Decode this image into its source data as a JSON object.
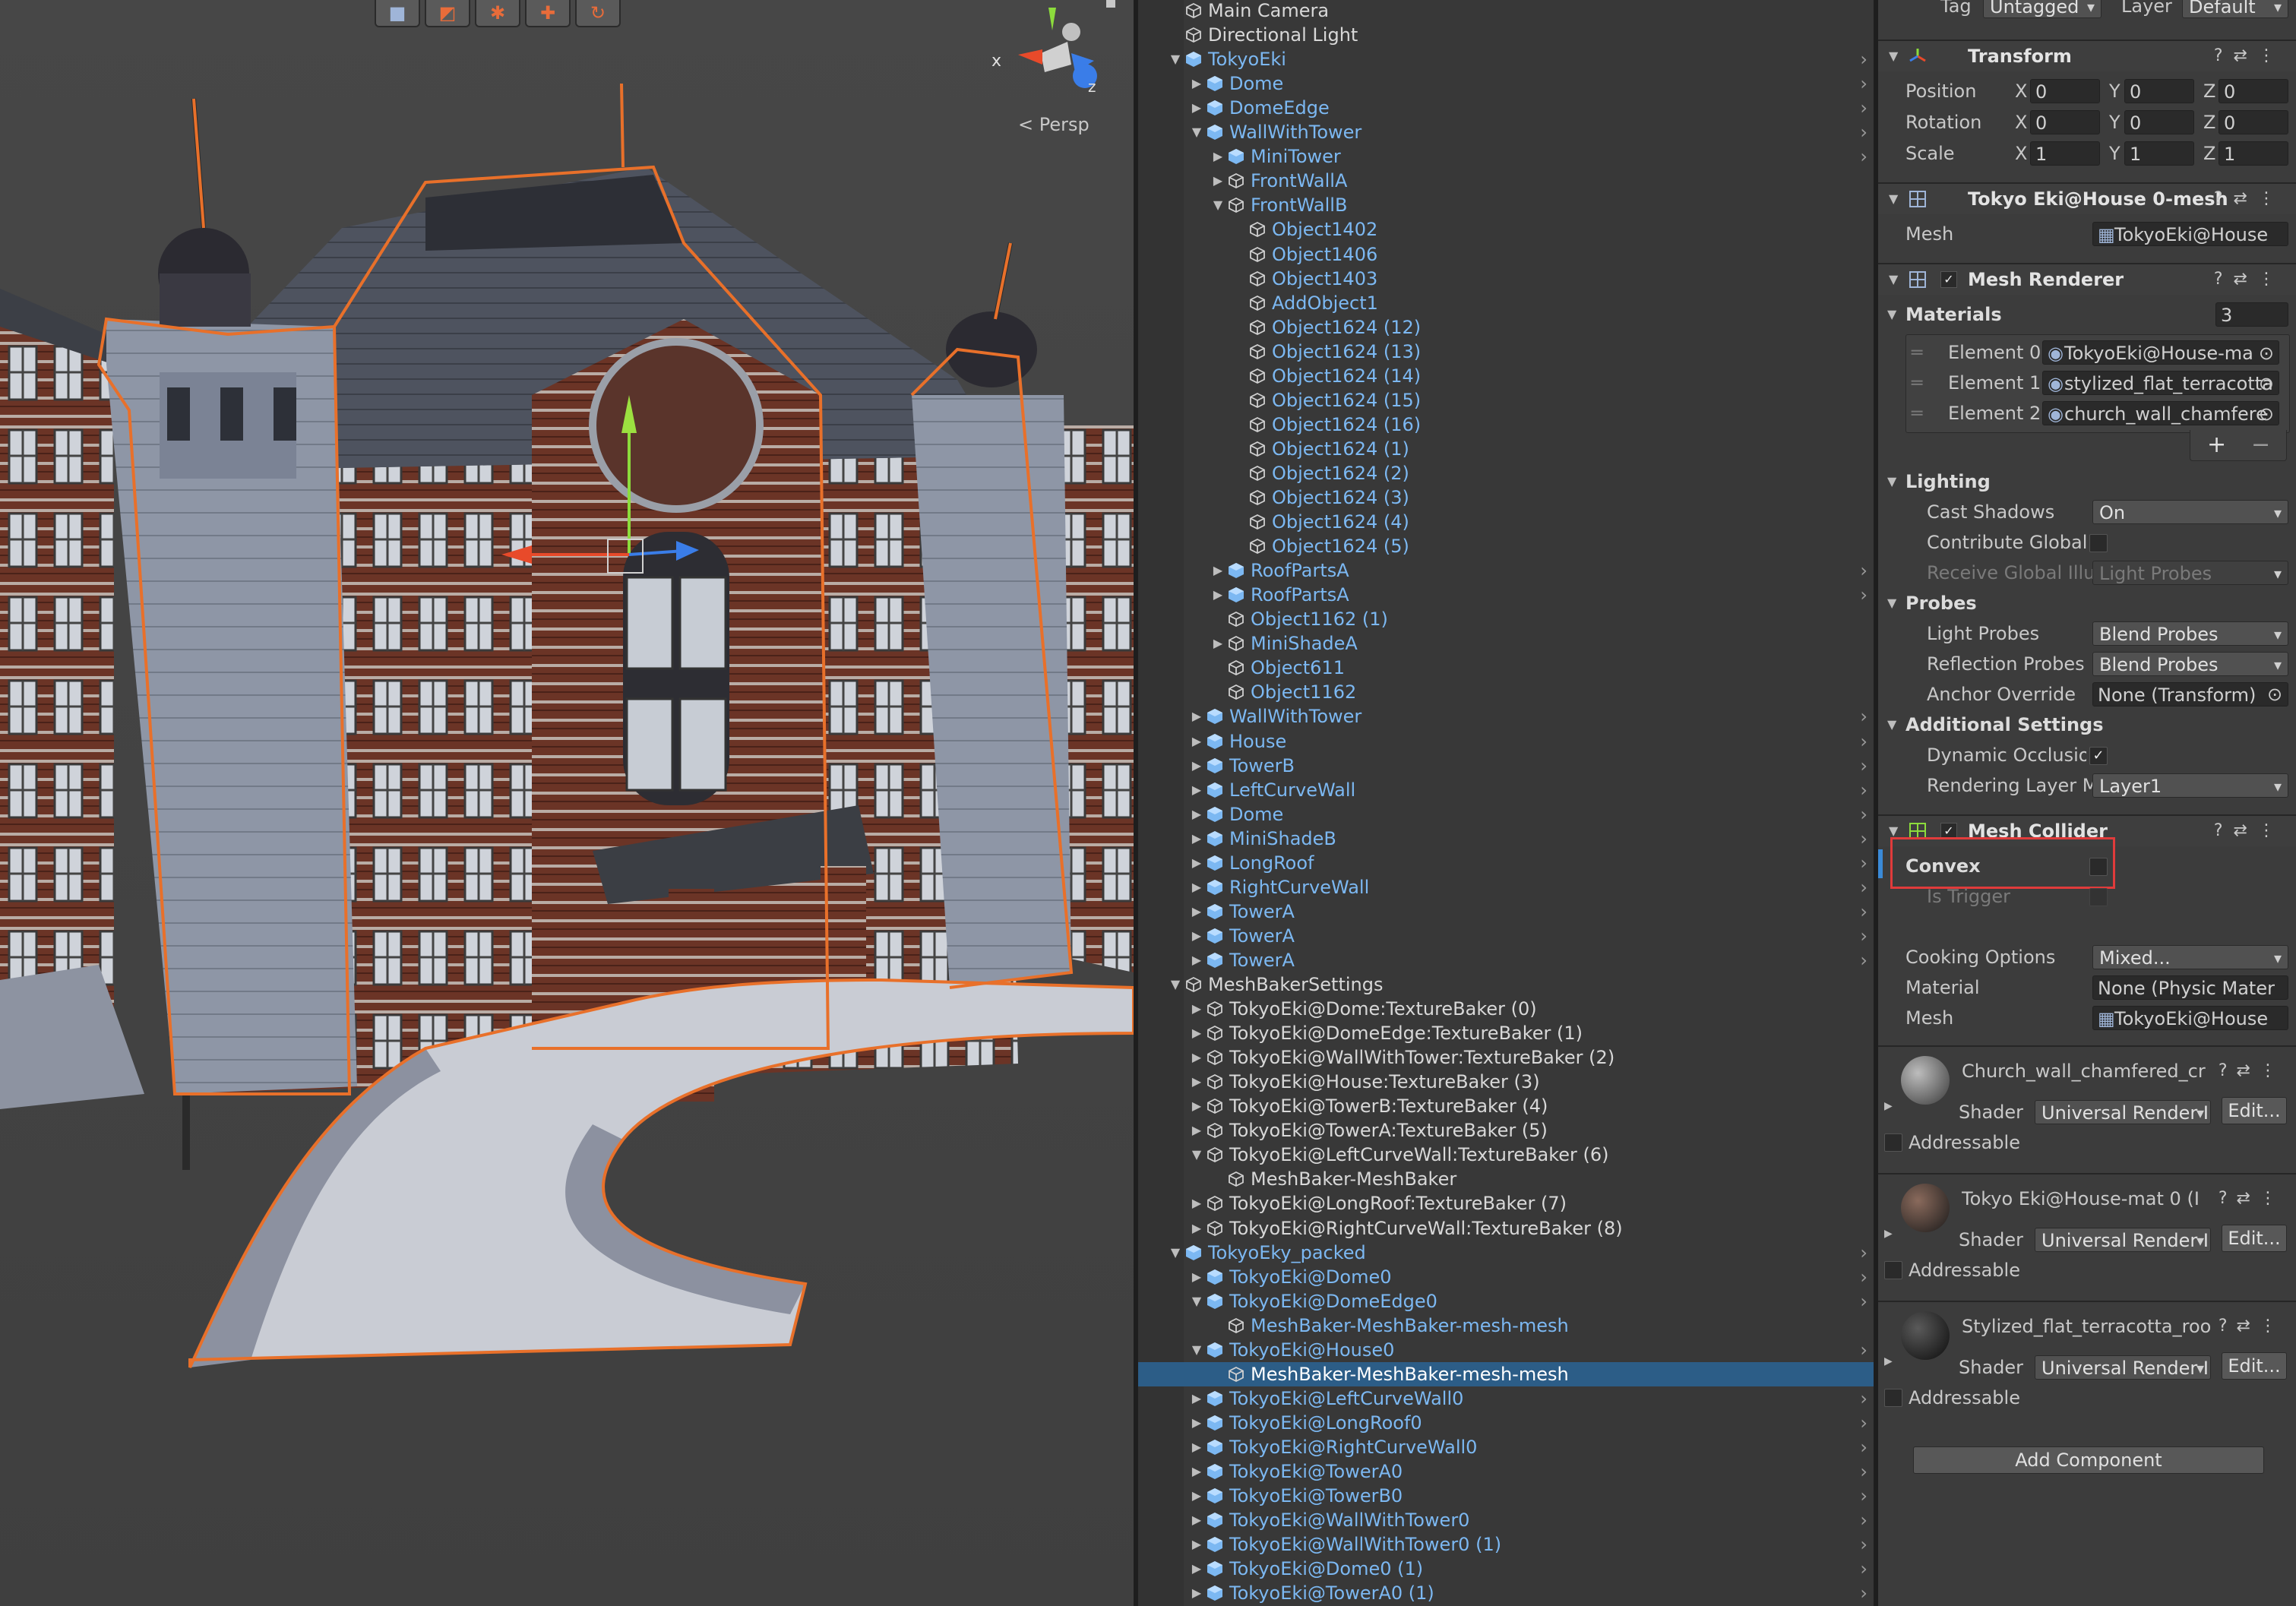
{
  "scene_view": {
    "tools": [
      "cube-icon",
      "rect-tool-icon",
      "gear-icon",
      "pivot-icon",
      "rotate-icon"
    ],
    "gizmo_axes": {
      "x": "x",
      "z": "z"
    },
    "projection_label": "Persp"
  },
  "hierarchy": {
    "rows": [
      {
        "label": "Main Camera",
        "depth": 0,
        "arrow": "",
        "type": "go",
        "chev": false
      },
      {
        "label": "Directional Light",
        "depth": 0,
        "arrow": "",
        "type": "go",
        "chev": false
      },
      {
        "label": "TokyoEki",
        "depth": 0,
        "arrow": "down",
        "type": "prefab-root",
        "chev": true
      },
      {
        "label": "Dome",
        "depth": 1,
        "arrow": "right",
        "type": "prefab",
        "chev": true
      },
      {
        "label": "DomeEdge",
        "depth": 1,
        "arrow": "right",
        "type": "prefab",
        "chev": true
      },
      {
        "label": "WallWithTower",
        "depth": 1,
        "arrow": "down",
        "type": "prefab",
        "chev": true
      },
      {
        "label": "MiniTower",
        "depth": 2,
        "arrow": "right",
        "type": "prefab",
        "chev": true
      },
      {
        "label": "FrontWallA",
        "depth": 2,
        "arrow": "right",
        "type": "prefab-go",
        "chev": false
      },
      {
        "label": "FrontWallB",
        "depth": 2,
        "arrow": "down",
        "type": "prefab-go",
        "chev": false
      },
      {
        "label": "Object1402",
        "depth": 3,
        "arrow": "",
        "type": "prefab-go",
        "chev": false
      },
      {
        "label": "Object1406",
        "depth": 3,
        "arrow": "",
        "type": "prefab-go",
        "chev": false
      },
      {
        "label": "Object1403",
        "depth": 3,
        "arrow": "",
        "type": "prefab-go",
        "chev": false
      },
      {
        "label": "AddObject1",
        "depth": 3,
        "arrow": "",
        "type": "prefab-go",
        "chev": false
      },
      {
        "label": "Object1624 (12)",
        "depth": 3,
        "arrow": "",
        "type": "prefab-go",
        "chev": false
      },
      {
        "label": "Object1624 (13)",
        "depth": 3,
        "arrow": "",
        "type": "prefab-go",
        "chev": false
      },
      {
        "label": "Object1624 (14)",
        "depth": 3,
        "arrow": "",
        "type": "prefab-go",
        "chev": false
      },
      {
        "label": "Object1624 (15)",
        "depth": 3,
        "arrow": "",
        "type": "prefab-go",
        "chev": false
      },
      {
        "label": "Object1624 (16)",
        "depth": 3,
        "arrow": "",
        "type": "prefab-go",
        "chev": false
      },
      {
        "label": "Object1624 (1)",
        "depth": 3,
        "arrow": "",
        "type": "prefab-go",
        "chev": false
      },
      {
        "label": "Object1624 (2)",
        "depth": 3,
        "arrow": "",
        "type": "prefab-go",
        "chev": false
      },
      {
        "label": "Object1624 (3)",
        "depth": 3,
        "arrow": "",
        "type": "prefab-go",
        "chev": false
      },
      {
        "label": "Object1624 (4)",
        "depth": 3,
        "arrow": "",
        "type": "prefab-go",
        "chev": false
      },
      {
        "label": "Object1624 (5)",
        "depth": 3,
        "arrow": "",
        "type": "prefab-go",
        "chev": false
      },
      {
        "label": "RoofPartsA",
        "depth": 2,
        "arrow": "right",
        "type": "prefab",
        "chev": true
      },
      {
        "label": "RoofPartsA",
        "depth": 2,
        "arrow": "right",
        "type": "prefab",
        "chev": true
      },
      {
        "label": "Object1162 (1)",
        "depth": 2,
        "arrow": "",
        "type": "prefab-go",
        "chev": false
      },
      {
        "label": "MiniShadeA",
        "depth": 2,
        "arrow": "right",
        "type": "prefab-go",
        "chev": false
      },
      {
        "label": "Object611",
        "depth": 2,
        "arrow": "",
        "type": "prefab-go",
        "chev": false
      },
      {
        "label": "Object1162",
        "depth": 2,
        "arrow": "",
        "type": "prefab-go",
        "chev": false
      },
      {
        "label": "WallWithTower",
        "depth": 1,
        "arrow": "right",
        "type": "prefab",
        "chev": true
      },
      {
        "label": "House",
        "depth": 1,
        "arrow": "right",
        "type": "prefab",
        "chev": true
      },
      {
        "label": "TowerB",
        "depth": 1,
        "arrow": "right",
        "type": "prefab",
        "chev": true
      },
      {
        "label": "LeftCurveWall",
        "depth": 1,
        "arrow": "right",
        "type": "prefab",
        "chev": true
      },
      {
        "label": "Dome",
        "depth": 1,
        "arrow": "right",
        "type": "prefab",
        "chev": true
      },
      {
        "label": "MiniShadeB",
        "depth": 1,
        "arrow": "right",
        "type": "prefab",
        "chev": true
      },
      {
        "label": "LongRoof",
        "depth": 1,
        "arrow": "right",
        "type": "prefab",
        "chev": true
      },
      {
        "label": "RightCurveWall",
        "depth": 1,
        "arrow": "right",
        "type": "prefab",
        "chev": true
      },
      {
        "label": "TowerA",
        "depth": 1,
        "arrow": "right",
        "type": "prefab",
        "chev": true
      },
      {
        "label": "TowerA",
        "depth": 1,
        "arrow": "right",
        "type": "prefab",
        "chev": true
      },
      {
        "label": "TowerA",
        "depth": 1,
        "arrow": "right",
        "type": "prefab",
        "chev": true
      },
      {
        "label": "MeshBakerSettings",
        "depth": 0,
        "arrow": "down",
        "type": "go",
        "chev": false
      },
      {
        "label": "TokyoEki@Dome:TextureBaker (0)",
        "depth": 1,
        "arrow": "right",
        "type": "go",
        "chev": false
      },
      {
        "label": "TokyoEki@DomeEdge:TextureBaker (1)",
        "depth": 1,
        "arrow": "right",
        "type": "go",
        "chev": false
      },
      {
        "label": "TokyoEki@WallWithTower:TextureBaker (2)",
        "depth": 1,
        "arrow": "right",
        "type": "go",
        "chev": false
      },
      {
        "label": "TokyoEki@House:TextureBaker (3)",
        "depth": 1,
        "arrow": "right",
        "type": "go",
        "chev": false
      },
      {
        "label": "TokyoEki@TowerB:TextureBaker (4)",
        "depth": 1,
        "arrow": "right",
        "type": "go",
        "chev": false
      },
      {
        "label": "TokyoEki@TowerA:TextureBaker (5)",
        "depth": 1,
        "arrow": "right",
        "type": "go",
        "chev": false
      },
      {
        "label": "TokyoEki@LeftCurveWall:TextureBaker (6)",
        "depth": 1,
        "arrow": "down",
        "type": "go",
        "chev": false
      },
      {
        "label": "MeshBaker-MeshBaker",
        "depth": 2,
        "arrow": "",
        "type": "go",
        "chev": false
      },
      {
        "label": "TokyoEki@LongRoof:TextureBaker (7)",
        "depth": 1,
        "arrow": "right",
        "type": "go",
        "chev": false
      },
      {
        "label": "TokyoEki@RightCurveWall:TextureBaker (8)",
        "depth": 1,
        "arrow": "right",
        "type": "go",
        "chev": false
      },
      {
        "label": "TokyoEky_packed",
        "depth": 0,
        "arrow": "down",
        "type": "prefab-root",
        "chev": true
      },
      {
        "label": "TokyoEki@Dome0",
        "depth": 1,
        "arrow": "right",
        "type": "prefab",
        "chev": true
      },
      {
        "label": "TokyoEki@DomeEdge0",
        "depth": 1,
        "arrow": "down",
        "type": "prefab",
        "chev": true
      },
      {
        "label": "MeshBaker-MeshBaker-mesh-mesh",
        "depth": 2,
        "arrow": "",
        "type": "prefab-go",
        "chev": false
      },
      {
        "label": "TokyoEki@House0",
        "depth": 1,
        "arrow": "down",
        "type": "prefab",
        "chev": true
      },
      {
        "label": "MeshBaker-MeshBaker-mesh-mesh",
        "depth": 2,
        "arrow": "",
        "type": "prefab-go",
        "chev": false,
        "selected": true
      },
      {
        "label": "TokyoEki@LeftCurveWall0",
        "depth": 1,
        "arrow": "right",
        "type": "prefab",
        "chev": true
      },
      {
        "label": "TokyoEki@LongRoof0",
        "depth": 1,
        "arrow": "right",
        "type": "prefab",
        "chev": true
      },
      {
        "label": "TokyoEki@RightCurveWall0",
        "depth": 1,
        "arrow": "right",
        "type": "prefab",
        "chev": true
      },
      {
        "label": "TokyoEki@TowerA0",
        "depth": 1,
        "arrow": "right",
        "type": "prefab",
        "chev": true
      },
      {
        "label": "TokyoEki@TowerB0",
        "depth": 1,
        "arrow": "right",
        "type": "prefab",
        "chev": true
      },
      {
        "label": "TokyoEki@WallWithTower0",
        "depth": 1,
        "arrow": "right",
        "type": "prefab",
        "chev": true
      },
      {
        "label": "TokyoEki@WallWithTower0 (1)",
        "depth": 1,
        "arrow": "right",
        "type": "prefab",
        "chev": true
      },
      {
        "label": "TokyoEki@Dome0 (1)",
        "depth": 1,
        "arrow": "right",
        "type": "prefab",
        "chev": true
      },
      {
        "label": "TokyoEki@TowerA0 (1)",
        "depth": 1,
        "arrow": "right",
        "type": "prefab",
        "chev": true
      }
    ]
  },
  "inspector": {
    "tag_label": "Tag",
    "tag_value": "Untagged",
    "layer_label": "Layer",
    "layer_value": "Default",
    "transform": {
      "title": "Transform",
      "position_label": "Position",
      "rotation_label": "Rotation",
      "scale_label": "Scale",
      "axis_x": "X",
      "axis_y": "Y",
      "axis_z": "Z",
      "position": {
        "x": "0",
        "y": "0",
        "z": "0"
      },
      "rotation": {
        "x": "0",
        "y": "0",
        "z": "0"
      },
      "scale": {
        "x": "1",
        "y": "1",
        "z": "1"
      }
    },
    "mesh_filter": {
      "title": "Tokyo Eki@House 0-mesh",
      "mesh_label": "Mesh",
      "mesh_value": "TokyoEki@House"
    },
    "mesh_renderer": {
      "title": "Mesh Renderer",
      "enabled_mark": "✓",
      "materials_label": "Materials",
      "materials_count": "3",
      "elements": [
        {
          "label": "Element 0",
          "value": "TokyoEki@House-ma"
        },
        {
          "label": "Element 1",
          "value": "stylized_flat_terracotta"
        },
        {
          "label": "Element 2",
          "value": "church_wall_chamfere"
        }
      ],
      "add_button": "+",
      "remove_button": "−",
      "lighting_label": "Lighting",
      "cast_shadows_label": "Cast Shadows",
      "cast_shadows_value": "On",
      "contribute_gi_label": "Contribute Global I",
      "receive_gi_label": "Receive Global Illu",
      "receive_gi_value": "Light Probes",
      "probes_label": "Probes",
      "light_probes_label": "Light Probes",
      "light_probes_value": "Blend Probes",
      "reflection_probes_label": "Reflection Probes",
      "reflection_probes_value": "Blend Probes",
      "anchor_override_label": "Anchor Override",
      "anchor_override_value": "None (Transform)",
      "additional_settings_label": "Additional Settings",
      "dynamic_occlusion_label": "Dynamic Occlusion",
      "dynamic_occlusion_mark": "✓",
      "rendering_layer_label": "Rendering Layer M",
      "rendering_layer_value": "Layer1"
    },
    "mesh_collider": {
      "title": "Mesh Collider",
      "enabled_mark": "✓",
      "convex_label": "Convex",
      "is_trigger_label": "Is Trigger",
      "cooking_label": "Cooking Options",
      "cooking_value": "Mixed...",
      "material_label": "Material",
      "material_value": "None (Physic Mater",
      "mesh_label": "Mesh",
      "mesh_value": "TokyoEki@House"
    },
    "materials": [
      {
        "title": "Church_wall_chamfered_cr",
        "shader_label": "Shader",
        "shader_value": "Universal Render I",
        "edit_label": "Edit...",
        "addressable_label": "Addressable"
      },
      {
        "title": "Tokyo Eki@House-mat 0 (I",
        "shader_label": "Shader",
        "shader_value": "Universal Render I",
        "edit_label": "Edit...",
        "addressable_label": "Addressable"
      },
      {
        "title": "Stylized_flat_terracotta_roo",
        "shader_label": "Shader",
        "shader_value": "Universal Render I",
        "edit_label": "Edit...",
        "addressable_label": "Addressable"
      }
    ],
    "add_component_label": "Add Component"
  },
  "colors": {
    "selection_outline": "#e8702a",
    "prefab_text": "#7cb8f2",
    "selected_row": "#2c5d87",
    "highlight_box": "#e03b3b"
  }
}
